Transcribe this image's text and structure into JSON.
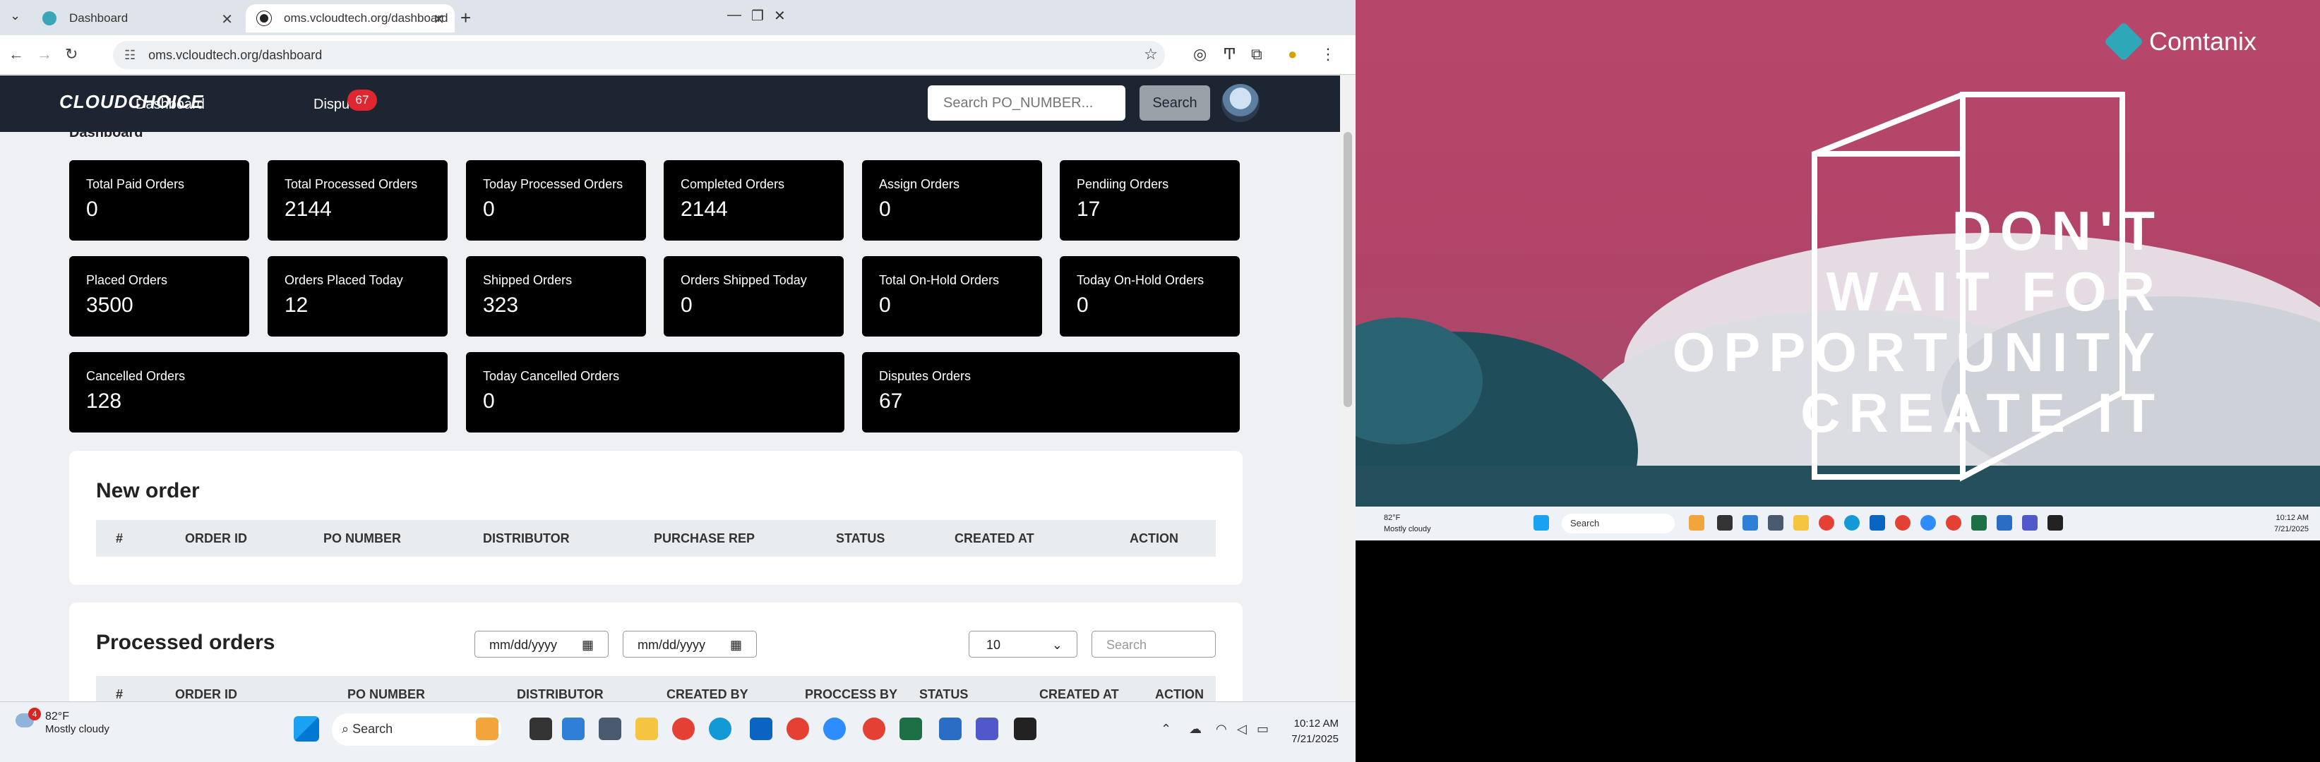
{
  "browser": {
    "tabs": [
      {
        "title": "Dashboard",
        "active": false
      },
      {
        "title": "oms.vcloudtech.org/dashboard",
        "active": true
      }
    ],
    "url": "oms.vcloudtech.org/dashboard"
  },
  "app": {
    "logo": "CLOUDCHOICE",
    "nav": {
      "dashboard": "Dashboard",
      "disputes": "Dispu",
      "disputes_badge": "67"
    },
    "search_placeholder": "Search PO_NUMBER...",
    "search_button": "Search"
  },
  "page": {
    "title": "Dashboard"
  },
  "cards": [
    {
      "label": "Total Paid Orders",
      "value": "0"
    },
    {
      "label": "Total Processed Orders",
      "value": "2144"
    },
    {
      "label": "Today Processed Orders",
      "value": "0"
    },
    {
      "label": "Completed Orders",
      "value": "2144"
    },
    {
      "label": "Assign Orders",
      "value": "0"
    },
    {
      "label": "Pendiing Orders",
      "value": "17"
    },
    {
      "label": "Placed Orders",
      "value": "3500"
    },
    {
      "label": "Orders Placed Today",
      "value": "12"
    },
    {
      "label": "Shipped Orders",
      "value": "323"
    },
    {
      "label": "Orders Shipped Today",
      "value": "0"
    },
    {
      "label": "Total On-Hold Orders",
      "value": "0"
    },
    {
      "label": "Today On-Hold Orders",
      "value": "0"
    },
    {
      "label": "Cancelled Orders",
      "value": "128"
    },
    {
      "label": "Today Cancelled Orders",
      "value": "0"
    },
    {
      "label": "Disputes Orders",
      "value": "67"
    }
  ],
  "new_order": {
    "title": "New order",
    "columns": [
      "#",
      "ORDER ID",
      "PO NUMBER",
      "DISTRIBUTOR",
      "PURCHASE REP",
      "STATUS",
      "CREATED AT",
      "ACTION"
    ]
  },
  "processed": {
    "title": "Processed orders",
    "date_from": "mm/dd/yyyy",
    "date_to": "mm/dd/yyyy",
    "page_size": "10",
    "search_placeholder": "Search",
    "columns": [
      "#",
      "ORDER ID",
      "PO NUMBER",
      "DISTRIBUTOR",
      "CREATED BY",
      "PROCCESS BY",
      "STATUS",
      "CREATED AT",
      "ACTION"
    ]
  },
  "taskbar": {
    "weather_badge": "4",
    "temp": "82°F",
    "condition": "Mostly cloudy",
    "search": "Search",
    "time": "10:12 AM",
    "date": "7/21/2025"
  },
  "wallpaper": {
    "brand": "Comtanix",
    "lines": [
      "DON'T",
      "WAIT FOR",
      "OPPORTUNITY",
      "CREATE IT"
    ]
  },
  "remote_taskbar": {
    "temp": "82°F",
    "condition": "Mostly cloudy",
    "search": "Search",
    "time": "10:12 AM",
    "date": "7/21/2025"
  }
}
